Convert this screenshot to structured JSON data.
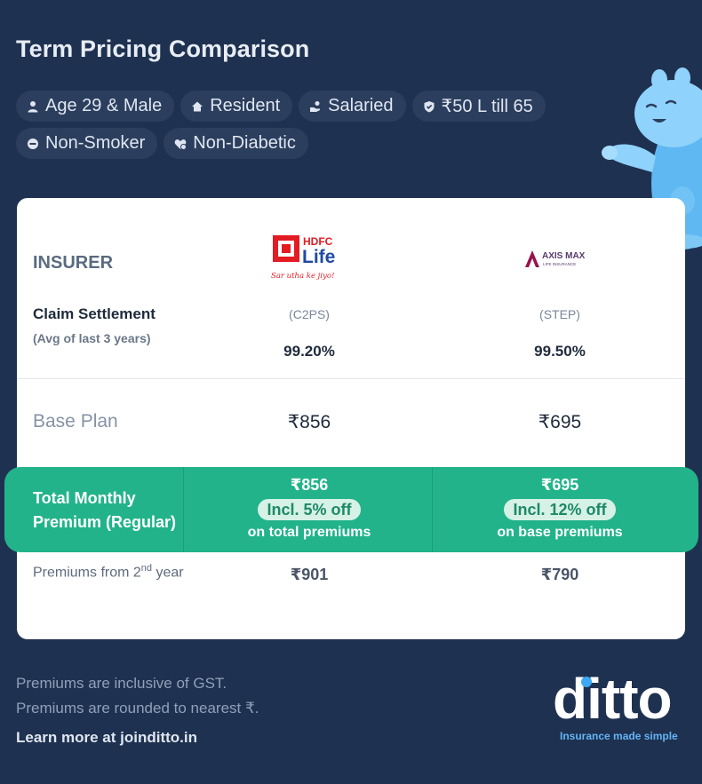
{
  "title": "Term Pricing Comparison",
  "chips": [
    {
      "icon": "person-icon",
      "label": "Age 29 & Male"
    },
    {
      "icon": "home-icon",
      "label": "Resident"
    },
    {
      "icon": "salary-icon",
      "label": "Salaried"
    },
    {
      "icon": "shield-icon",
      "label": "₹50 L till 65"
    },
    {
      "icon": "no-smoking-icon",
      "label": "Non-Smoker"
    },
    {
      "icon": "heart-check-icon",
      "label": "Non-Diabetic"
    }
  ],
  "table": {
    "insurer_label": "INSURER",
    "claim_label": "Claim Settlement",
    "claim_sub": "(Avg of last 3 years)",
    "base_label": "Base Plan",
    "total_label": "Total Monthly Premium (Regular)",
    "renew_label": "Premiums from 2",
    "renew_sup": "nd",
    "renew_tail": " year",
    "insurers": [
      {
        "logo_name": "hdfc-life-logo",
        "logo_text": "HDFC",
        "logo_text2": "Life",
        "logo_tagline": "Sar utha ke jiyo!",
        "plan_code": "(C2PS)",
        "claim": "99.20%",
        "base": "₹856",
        "total": "₹856",
        "discount": "Incl. 5% off",
        "discount_note": "on total premiums",
        "renewal": "₹901"
      },
      {
        "logo_name": "axis-max-logo",
        "logo_text": "AXIS MAX",
        "logo_text2": "LIFE INSURANCE",
        "plan_code": "(STEP)",
        "claim": "99.50%",
        "base": "₹695",
        "total": "₹695",
        "discount": "Incl. 12% off",
        "discount_note": "on base premiums",
        "renewal": "₹790"
      }
    ]
  },
  "footer": {
    "note1": "Premiums are inclusive of GST.",
    "note2": "Premiums are rounded to nearest ₹.",
    "link": "Learn more at joinditto.in",
    "brand": "ditto",
    "tagline": "Insurance made simple"
  },
  "colors": {
    "background": "#1f3150",
    "accent_green": "#22b38a",
    "brand_blue": "#3da8f5"
  }
}
